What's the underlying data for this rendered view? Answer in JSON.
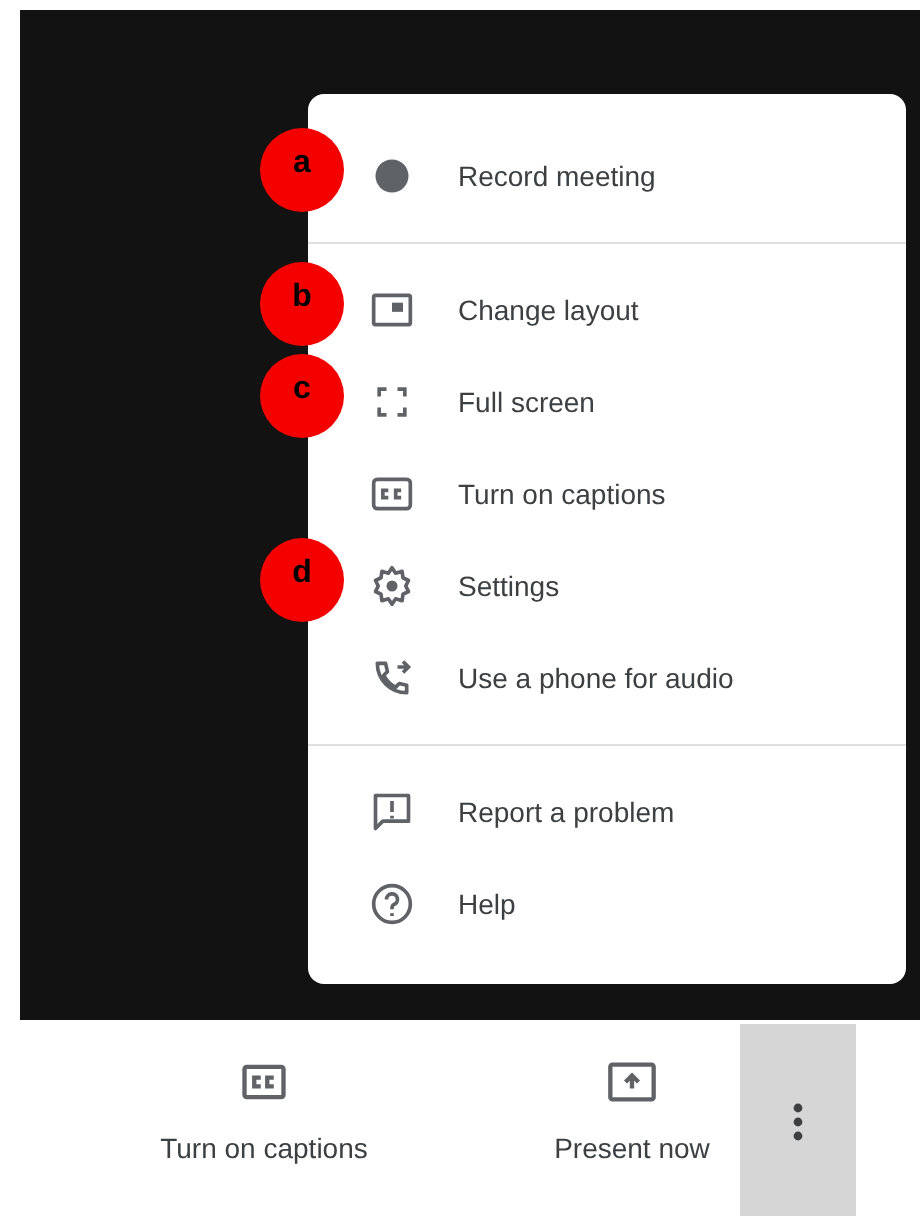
{
  "menu": {
    "groups": [
      [
        {
          "label": "Record meeting",
          "callout": "a"
        }
      ],
      [
        {
          "label": "Change layout",
          "callout": "b"
        },
        {
          "label": "Full screen",
          "callout": "c"
        },
        {
          "label": "Turn on captions"
        },
        {
          "label": "Settings",
          "callout": "d"
        },
        {
          "label": "Use a phone for audio"
        }
      ],
      [
        {
          "label": "Report a problem"
        },
        {
          "label": "Help"
        }
      ]
    ]
  },
  "toolbar": {
    "buttons": [
      {
        "label": "Turn on captions",
        "selected": false
      },
      {
        "label": "Present now",
        "selected": false
      },
      {
        "selected": true
      }
    ]
  }
}
